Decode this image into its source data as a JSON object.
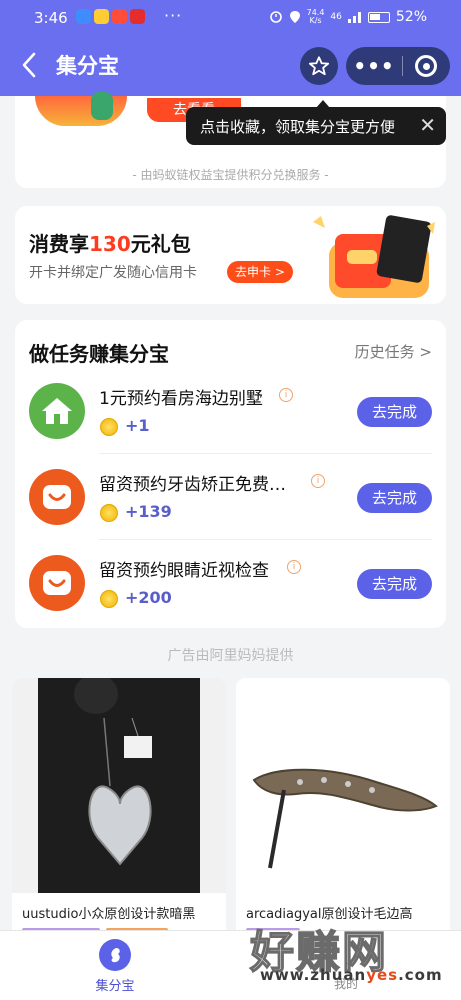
{
  "status_bar": {
    "time": "3:46",
    "more_dots": "···",
    "net_speed": "74.4",
    "net_unit": "K/s",
    "signal": "46",
    "battery": "52%"
  },
  "header": {
    "title": "集分宝",
    "more_label": "•••"
  },
  "tooltip": {
    "text": "点击收藏，领取集分宝更方便"
  },
  "top_card": {
    "button_label": "去看看",
    "provided_by": "- 由蚂蚁链权益宝提供积分兑换服务 -"
  },
  "promo": {
    "title_prefix": "消费享",
    "title_highlight": "130",
    "title_suffix": "元礼包",
    "subtitle": "开卡并绑定广发随心信用卡",
    "button_label": "去申卡 >"
  },
  "tasks": {
    "title": "做任务赚集分宝",
    "history_label": "历史任务 >",
    "items": [
      {
        "name": "1元预约看房海边别墅",
        "reward": "+1",
        "button": "去完成",
        "icon": "house-icon",
        "icon_color": "#5cb34a"
      },
      {
        "name": "留资预约牙齿矫正免费…",
        "reward": "+139",
        "button": "去完成",
        "icon": "smile-icon",
        "icon_color": "#ec5a1e"
      },
      {
        "name": "留资预约眼睛近视检查",
        "reward": "+200",
        "button": "去完成",
        "icon": "smile-icon",
        "icon_color": "#ec5a1e"
      }
    ]
  },
  "ad_note": "广告由阿里妈妈提供",
  "products": [
    {
      "name": "uustudio小众原创设计款暗黑"
    },
    {
      "name": "arcadiagyal原创设计毛边高"
    }
  ],
  "tabbar": {
    "active_label": "集分宝",
    "mine_label": "我的"
  },
  "watermark": {
    "big": "好赚网",
    "url_a": "www.zhuan",
    "url_b": "yes",
    "url_c": ".com"
  },
  "colors": {
    "header_bg": "#6a6ff0",
    "accent_button": "#5b62e8",
    "promo_red": "#ff3b1f"
  }
}
